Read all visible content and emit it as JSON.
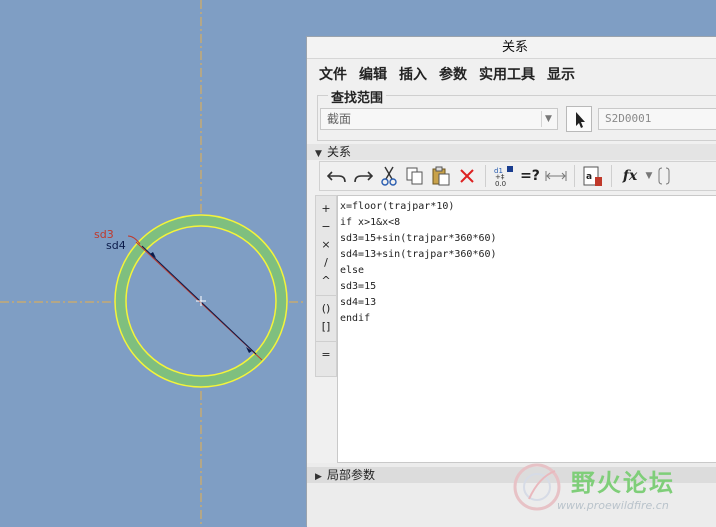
{
  "dimensions": {
    "sd3": {
      "label": "sd3",
      "color": "#c0392b"
    },
    "sd4": {
      "label": "sd4",
      "color": "#0a1a4a"
    }
  },
  "colors": {
    "background": "#7f9ec4",
    "ring_fill": "#7fbf7f",
    "ring_edge": "#f4f43a",
    "centerline": "#e8b04a"
  },
  "dialog": {
    "title": "关系",
    "menu": [
      "文件",
      "编辑",
      "插入",
      "参数",
      "实用工具",
      "显示"
    ],
    "scope": {
      "legend": "查找范围",
      "selected": "截面",
      "field_value": "S2D0001"
    },
    "relations_header": "关系",
    "toolbar": {
      "undo_icon": "undo-icon",
      "redo_icon": "redo-icon",
      "cut_icon": "scissors-icon",
      "copy_icon": "copy-icon",
      "paste_icon": "paste-icon",
      "delete_icon": "delete-icon",
      "evaluate_label": "=?",
      "fx_label": "fx"
    },
    "operators": [
      "+",
      "−",
      "×",
      "/",
      "^",
      "()",
      "[]",
      "="
    ],
    "relations": [
      "x=floor(trajpar*10)",
      "if x>1&x<8",
      "sd3=15+sin(trajpar*360*60)",
      "sd4=13+sin(trajpar*360*60)",
      "else",
      "sd3=15",
      "sd4=13",
      "endif"
    ],
    "local_params_header": "局部参数"
  },
  "watermark": {
    "title": "野火论坛",
    "url": "www.proewildfire.cn"
  }
}
